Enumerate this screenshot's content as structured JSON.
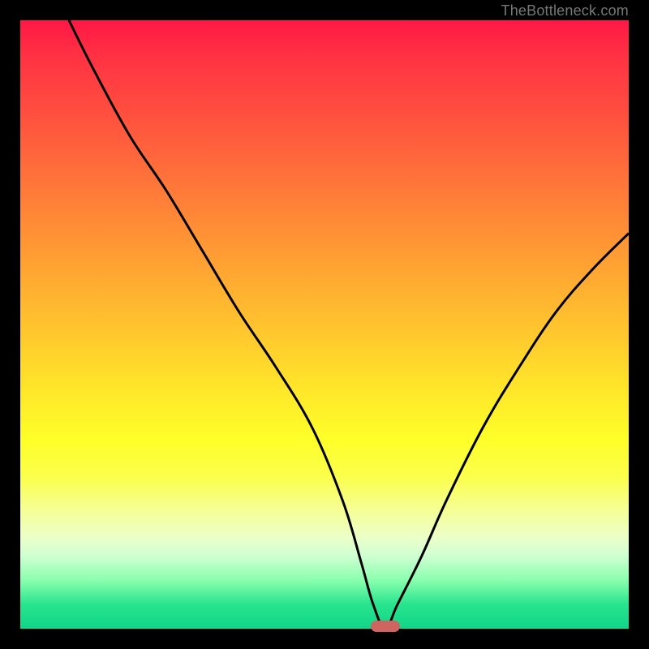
{
  "watermark": "TheBottleneck.com",
  "colors": {
    "curve_stroke": "#000000",
    "marker_fill": "#cf6561",
    "frame": "#000000"
  },
  "chart_data": {
    "type": "line",
    "title": "",
    "xlabel": "",
    "ylabel": "",
    "xlim": [
      0,
      100
    ],
    "ylim": [
      0,
      100
    ],
    "grid": false,
    "legend": false,
    "series": [
      {
        "name": "bottleneck-curve",
        "x": [
          8,
          12,
          18,
          24,
          30,
          36,
          42,
          48,
          53,
          56,
          58,
          60,
          62,
          66,
          70,
          76,
          82,
          88,
          94,
          100
        ],
        "values": [
          100,
          92,
          81,
          72,
          62,
          52,
          43,
          33,
          21,
          11,
          4,
          0,
          4,
          12,
          21,
          33,
          43,
          52,
          59,
          65
        ]
      }
    ],
    "annotations": [
      {
        "type": "marker",
        "shape": "pill",
        "x": 60,
        "y": 0,
        "color": "#cf6561"
      }
    ]
  }
}
